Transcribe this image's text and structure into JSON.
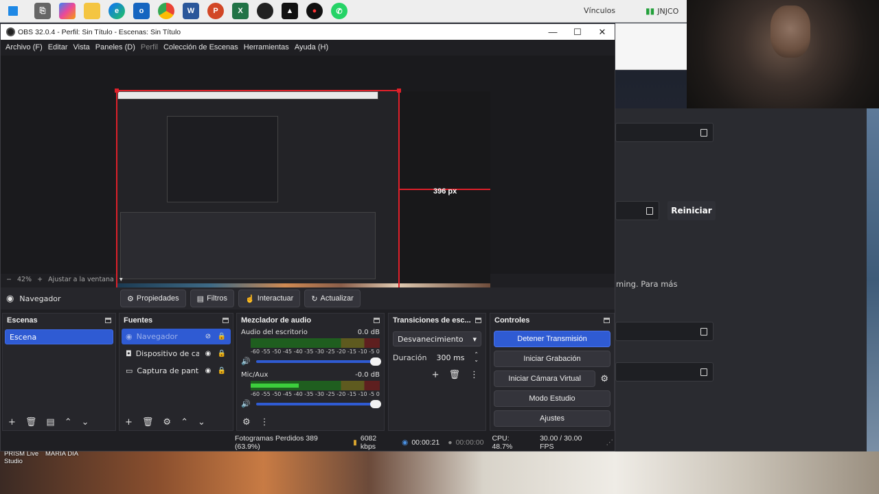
{
  "taskbar": {
    "links_label": "Vínculos",
    "user_label": "JNJCO",
    "icons": [
      "windows-start-icon",
      "snip-icon",
      "copilot-icon",
      "file-explorer-icon",
      "edge-icon",
      "outlook-icon",
      "chrome-icon",
      "word-icon",
      "powerpoint-icon",
      "excel-icon",
      "obs-icon",
      "capcut-icon",
      "prism-icon",
      "whatsapp-icon"
    ]
  },
  "window": {
    "title": "OBS 32.0.4 - Perfil: Sin Título - Escenas: Sin Título"
  },
  "menu": [
    "Archivo (F)",
    "Editar",
    "Vista",
    "Paneles (D)",
    "Perfil",
    "Colección de Escenas",
    "Herramientas",
    "Ayuda (H)"
  ],
  "preview": {
    "px_label": "396 px",
    "zoom": "42%",
    "fit_label": "Ajustar a la ventana"
  },
  "source_toolbar": {
    "selected_source": "Navegador",
    "buttons": [
      "Propiedades",
      "Filtros",
      "Interactuar",
      "Actualizar"
    ]
  },
  "scenes": {
    "title": "Escenas",
    "items": [
      "Escena"
    ]
  },
  "sources": {
    "title": "Fuentes",
    "items": [
      "Navegador",
      "Dispositivo de captura",
      "Captura de pantalla"
    ]
  },
  "mixer": {
    "title": "Mezclador de audio",
    "channels": [
      {
        "name": "Audio del escritorio",
        "db": "0.0 dB",
        "level": 0.0
      },
      {
        "name": "Mic/Aux",
        "db": "-0.0 dB",
        "level": 0.37
      }
    ],
    "ticks": [
      "-60",
      "-55",
      "-50",
      "-45",
      "-40",
      "-35",
      "-30",
      "-25",
      "-20",
      "-15",
      "-10",
      "-5",
      "0"
    ]
  },
  "transitions": {
    "title": "Transiciones de esc...",
    "selected": "Desvanecimiento",
    "duration_label": "Duración",
    "duration_value": "300 ms"
  },
  "controls": {
    "title": "Controles",
    "buttons": [
      "Detener Transmisión",
      "Iniciar Grabación",
      "Iniciar Cámara Virtual",
      "Modo Estudio",
      "Ajustes"
    ]
  },
  "status": {
    "dropped": "Fotogramas Perdidos 389 (63.9%)",
    "bitrate": "6082 kbps",
    "stream_time": "00:00:21",
    "rec_time": "00:00:00",
    "cpu": "CPU: 48.7%",
    "fps": "30.00 / 30.00 FPS"
  },
  "background": {
    "reiniciar": "Reiniciar",
    "text_fragment": "ming. Para más",
    "prism_label": "PRISM Live Studio",
    "maria_label": "MARIA DIA"
  }
}
